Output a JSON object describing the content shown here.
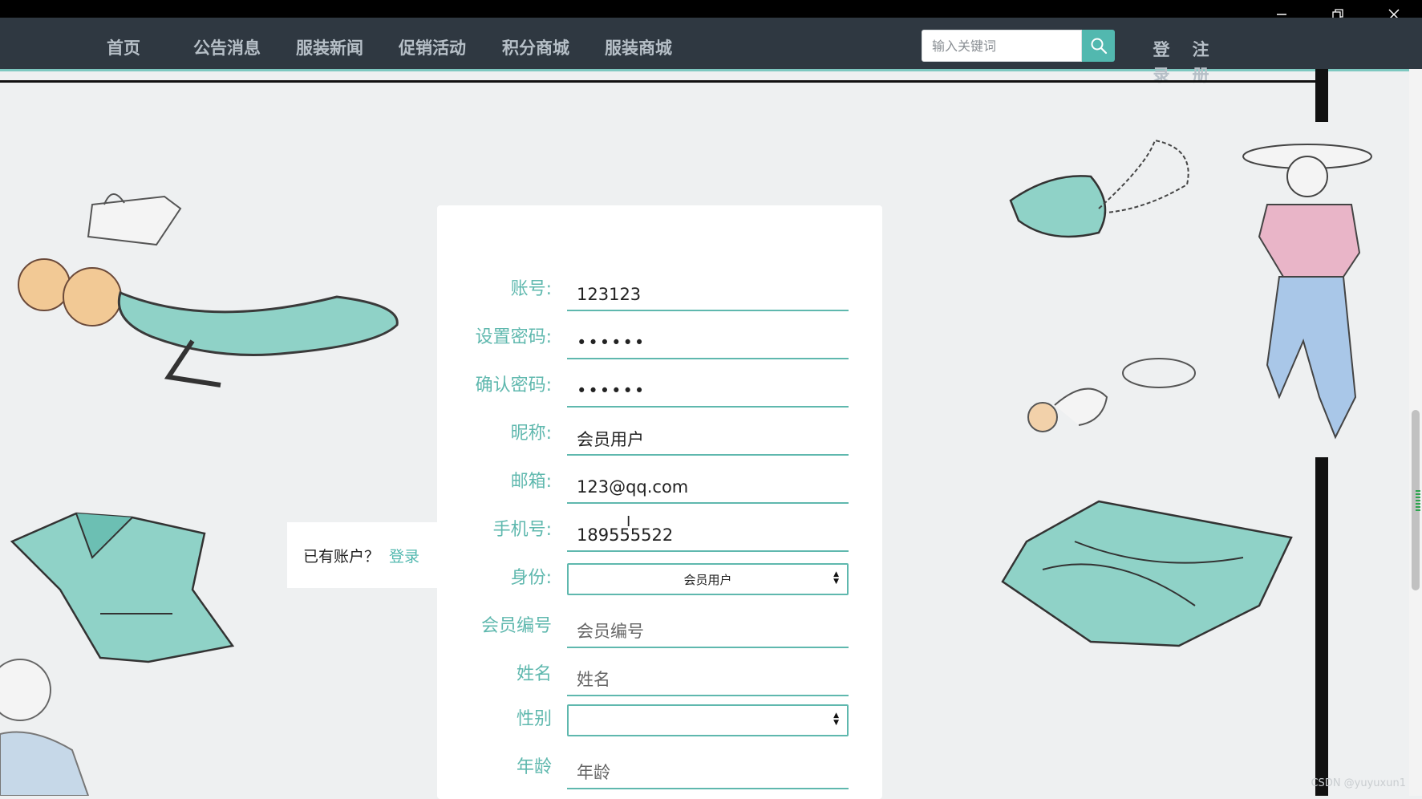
{
  "nav": {
    "items": [
      "首页",
      "公告消息",
      "服装新闻",
      "促销活动",
      "积分商城",
      "服装商城"
    ],
    "search_placeholder": "输入关键词",
    "login": [
      "登",
      "录"
    ],
    "register": [
      "注",
      "册"
    ]
  },
  "login_prompt": {
    "text": "已有账户？",
    "link": "登录"
  },
  "form": {
    "account": {
      "label": "账号:",
      "value": "123123"
    },
    "password": {
      "label": "设置密码:",
      "value": "••••••"
    },
    "confirm_password": {
      "label": "确认密码:",
      "value": "••••••"
    },
    "nickname": {
      "label": "昵称:",
      "value": "会员用户"
    },
    "email": {
      "label": "邮箱:",
      "value": "123@qq.com"
    },
    "phone": {
      "label": "手机号:",
      "value": "189555522"
    },
    "role": {
      "label": "身份:",
      "value": "会员用户"
    },
    "member_no": {
      "label": "会员编号",
      "placeholder": "会员编号"
    },
    "name": {
      "label": "姓名",
      "placeholder": "姓名"
    },
    "gender": {
      "label": "性别",
      "value": ""
    },
    "age": {
      "label": "年龄",
      "placeholder": "年龄"
    }
  },
  "watermark": "CSDN @yuyuxun1",
  "colors": {
    "accent": "#52b8af",
    "nav_bg": "#2f3841",
    "label": "#5fb8ae"
  }
}
